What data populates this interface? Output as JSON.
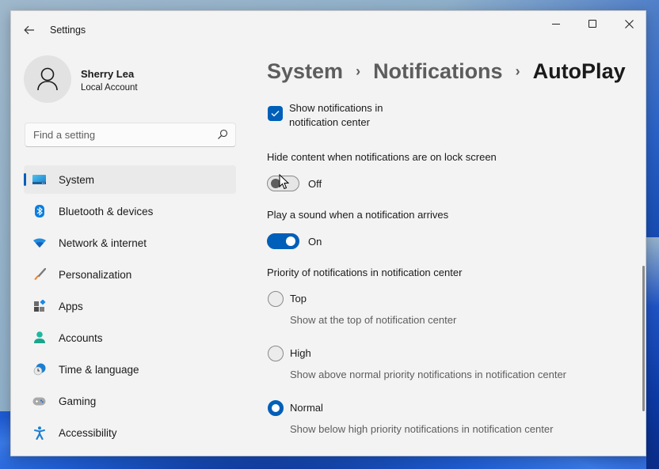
{
  "window": {
    "app_title": "Settings",
    "controls": {
      "back": "back-arrow-icon",
      "minimize": "minimize-icon",
      "maximize": "maximize-icon",
      "close": "close-icon"
    }
  },
  "profile": {
    "name": "Sherry Lea",
    "account_type": "Local Account",
    "avatar_icon": "person-icon"
  },
  "search": {
    "placeholder": "Find a setting",
    "value": "",
    "icon": "search-icon"
  },
  "sidebar": {
    "items": [
      {
        "label": "System",
        "icon": "system-display-icon",
        "active": true
      },
      {
        "label": "Bluetooth & devices",
        "icon": "bluetooth-icon",
        "active": false
      },
      {
        "label": "Network & internet",
        "icon": "wifi-icon",
        "active": false
      },
      {
        "label": "Personalization",
        "icon": "paintbrush-icon",
        "active": false
      },
      {
        "label": "Apps",
        "icon": "apps-icon",
        "active": false
      },
      {
        "label": "Accounts",
        "icon": "accounts-icon",
        "active": false
      },
      {
        "label": "Time & language",
        "icon": "time-language-icon",
        "active": false
      },
      {
        "label": "Gaming",
        "icon": "gamepad-icon",
        "active": false
      },
      {
        "label": "Accessibility",
        "icon": "accessibility-icon",
        "active": false
      }
    ]
  },
  "breadcrumb": {
    "items": [
      "System",
      "Notifications",
      "AutoPlay"
    ],
    "separator": "›"
  },
  "settings": {
    "show_in_center": {
      "label": "Show notifications in notification center",
      "checked": true
    },
    "hide_content": {
      "label": "Hide content when notifications are on lock screen",
      "state": "Off",
      "on": false
    },
    "play_sound": {
      "label": "Play a sound when a notification arrives",
      "state": "On",
      "on": true
    },
    "priority": {
      "label": "Priority of notifications in notification center",
      "selected": "Normal",
      "options": [
        {
          "label": "Top",
          "description": "Show at the top of notification center"
        },
        {
          "label": "High",
          "description": "Show above normal priority notifications in notification center"
        },
        {
          "label": "Normal",
          "description": "Show below high priority notifications in notification center"
        }
      ]
    }
  },
  "colors": {
    "accent": "#005fb8",
    "window_bg": "#f3f3f3",
    "active_nav_bg": "#eaeaea"
  }
}
